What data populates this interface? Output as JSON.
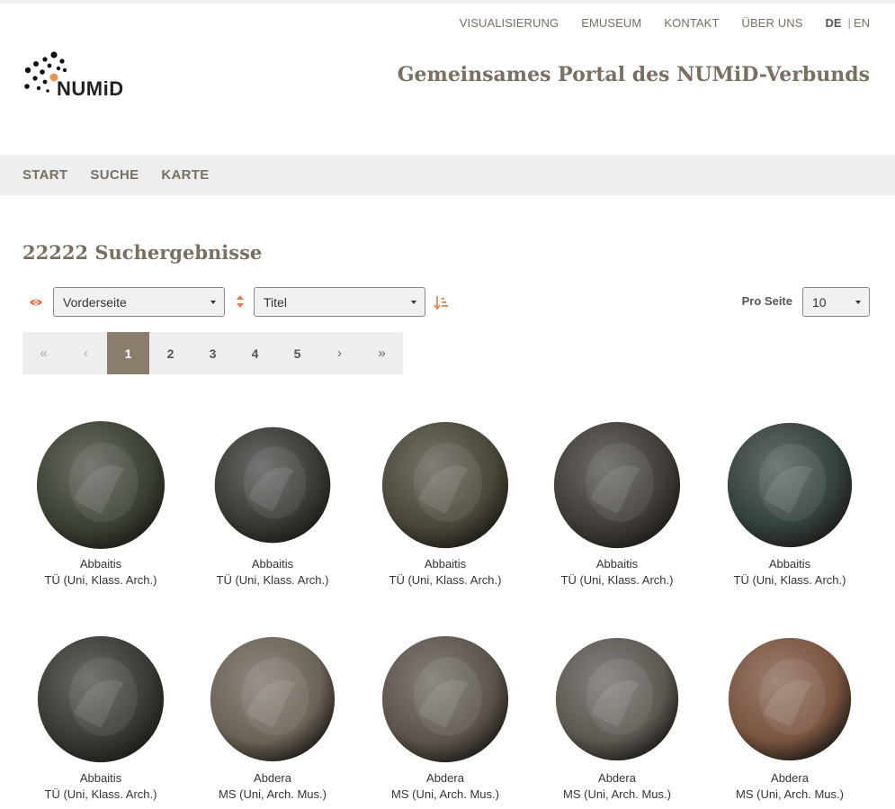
{
  "topnav": {
    "items": [
      "VISUALISIERUNG",
      "EMUSEUM",
      "KONTAKT",
      "ÜBER UNS"
    ],
    "lang_de": "DE",
    "lang_sep": "|",
    "lang_en": "EN"
  },
  "logo": {
    "text": "NUMiD"
  },
  "header": {
    "title": "Gemeinsames Portal des NUMiD-Verbunds"
  },
  "mainnav": {
    "items": [
      "START",
      "SUCHE",
      "KARTE"
    ]
  },
  "results": {
    "title": "22222 Suchergebnisse"
  },
  "controls": {
    "face_value": "Vorderseite",
    "sort_value": "Titel",
    "perpage_label": "Pro Seite",
    "perpage_value": "10"
  },
  "pagination": {
    "first": "«",
    "prev": "‹",
    "pages": [
      "1",
      "2",
      "3",
      "4",
      "5"
    ],
    "current": "1",
    "next": "›",
    "last": "»"
  },
  "accent_color": "#e07b4f",
  "brand_color": "#7a6f63",
  "coins": [
    {
      "title": "Abbaitis",
      "collection": "TÜ (Uni, Klass. Arch.)",
      "tone": "#3b4035"
    },
    {
      "title": "Abbaitis",
      "collection": "TÜ (Uni, Klass. Arch.)",
      "tone": "#3a3936"
    },
    {
      "title": "Abbaitis",
      "collection": "TÜ (Uni, Klass. Arch.)",
      "tone": "#4a463a"
    },
    {
      "title": "Abbaitis",
      "collection": "TÜ (Uni, Klass. Arch.)",
      "tone": "#3f3c38"
    },
    {
      "title": "Abbaitis",
      "collection": "TÜ (Uni, Klass. Arch.)",
      "tone": "#34403a"
    },
    {
      "title": "Abbaitis",
      "collection": "TÜ (Uni, Klass. Arch.)",
      "tone": "#3a3834"
    },
    {
      "title": "Abdera",
      "collection": "MS (Uni, Arch. Mus.)",
      "tone": "#6b6258"
    },
    {
      "title": "Abdera",
      "collection": "MS (Uni, Arch. Mus.)",
      "tone": "#5b544c"
    },
    {
      "title": "Abdera",
      "collection": "MS (Uni, Arch. Mus.)",
      "tone": "#5d5852"
    },
    {
      "title": "Abdera",
      "collection": "MS (Uni, Arch. Mus.)",
      "tone": "#7a5440"
    }
  ]
}
